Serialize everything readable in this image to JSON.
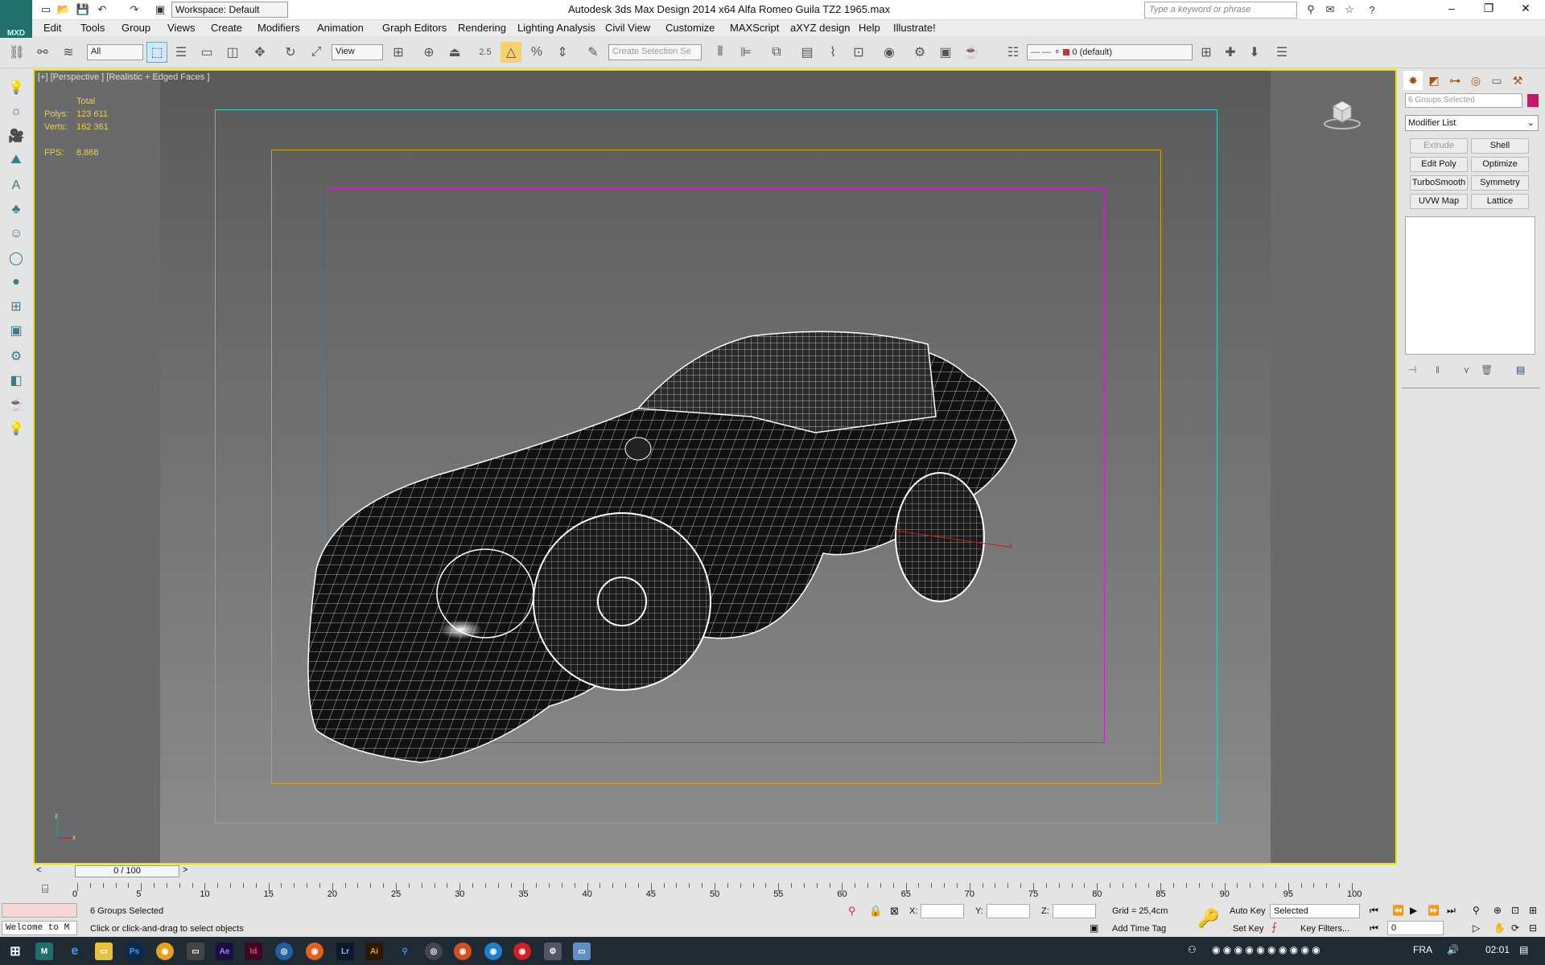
{
  "titlebar": {
    "app_title": "Autodesk 3ds Max Design 2014 x64    Alfa Romeo Guila TZ2 1965.max",
    "logo_text": "MXD",
    "workspace": "Workspace: Default",
    "search_placeholder": "Type a keyword or phrase"
  },
  "menu": [
    "Edit",
    "Tools",
    "Group",
    "Views",
    "Create",
    "Modifiers",
    "Animation",
    "Graph Editors",
    "Rendering",
    "Lighting Analysis",
    "Civil View",
    "Customize",
    "MAXScript",
    "aXYZ design",
    "Help",
    "Illustrate!"
  ],
  "toolbar": {
    "filter": "All",
    "ref_coord": "View",
    "snap_value": "2.5",
    "selection_set_placeholder": "Create Selection Se",
    "layer": "0 (default)"
  },
  "viewport": {
    "label": "[+] [Perspective ] [Realistic + Edged Faces ]",
    "stats_header": "Total",
    "polys_label": "Polys:",
    "polys_value": "123 611",
    "verts_label": "Verts:",
    "verts_value": "162 361",
    "fps_label": "FPS:",
    "fps_value": "8,868"
  },
  "command_panel": {
    "name_field": "6 Groups Selected",
    "modifier_list": "Modifier List",
    "buttons": [
      "Extrude",
      "Shell",
      "Edit Poly",
      "Optimize",
      "TurboSmooth",
      "Symmetry",
      "UVW Map",
      "Lattice"
    ]
  },
  "timeline": {
    "slider": "0 / 100",
    "ticks": [
      "0",
      "5",
      "10",
      "15",
      "20",
      "25",
      "30",
      "35",
      "40",
      "45",
      "50",
      "55",
      "60",
      "65",
      "70",
      "75",
      "80",
      "85",
      "90",
      "95",
      "100"
    ]
  },
  "status": {
    "maxscript": "Welcome to M",
    "selection": "6 Groups Selected",
    "prompt": "Click or click-and-drag to select objects",
    "x_label": "X:",
    "y_label": "Y:",
    "z_label": "Z:",
    "grid": "Grid = 25,4cm",
    "auto_key": "Auto Key",
    "set_key": "Set Key",
    "selected": "Selected",
    "key_filters": "Key Filters...",
    "add_time_tag": "Add Time Tag",
    "frame": "0"
  },
  "taskbar": {
    "lang": "FRA",
    "time": "02:01",
    "apps": [
      "Ps",
      "Lr",
      "Ae",
      "Id",
      "Ai"
    ]
  },
  "colors": {
    "viewport_border": "#f0e000",
    "safe_frame_outer": "#38c8c8",
    "safe_frame_mid": "#d8a020",
    "safe_frame_inner": "#d020d0",
    "stats_text": "#e8d04a"
  }
}
